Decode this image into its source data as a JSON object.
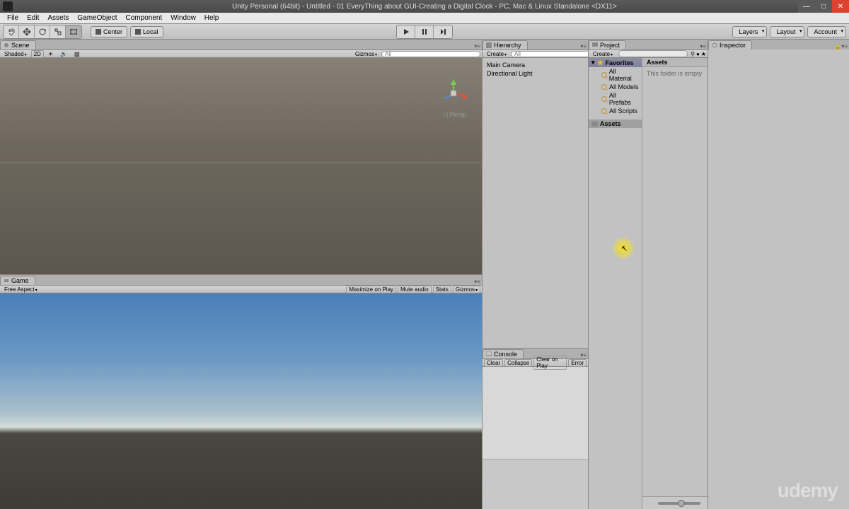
{
  "titlebar": {
    "text": "Unity Personal (64bit) - Untitled - 01 EveryThing about GUI-Creating a Digital Clock - PC, Mac & Linux Standalone <DX11>"
  },
  "menubar": [
    "File",
    "Edit",
    "Assets",
    "GameObject",
    "Component",
    "Window",
    "Help"
  ],
  "toolbar": {
    "pivot_center": "Center",
    "pivot_local": "Local",
    "layers": "Layers",
    "layout": "Layout",
    "account": "Account"
  },
  "scene": {
    "tab": "Scene",
    "shaded": "Shaded",
    "twod": "2D",
    "gizmos": "Gizmos",
    "persp": "Persp"
  },
  "game": {
    "tab": "Game",
    "aspect": "Free Aspect",
    "maximize": "Maximize on Play",
    "mute": "Mute audio",
    "stats": "Stats",
    "gizmos": "Gizmos"
  },
  "hierarchy": {
    "tab": "Hierarchy",
    "create": "Create",
    "search_placeholder": "All",
    "items": [
      "Main Camera",
      "Directional Light"
    ]
  },
  "console": {
    "tab": "Console",
    "clear": "Clear",
    "collapse": "Collapse",
    "clear_on_play": "Clear on Play",
    "error": "Error"
  },
  "project": {
    "tab": "Project",
    "create": "Create",
    "favorites": "Favorites",
    "fav_items": [
      "All Material",
      "All Models",
      "All Prefabs",
      "All Scripts"
    ],
    "assets": "Assets",
    "breadcrumb": "Assets",
    "empty_msg": "This folder is empty"
  },
  "inspector": {
    "tab": "Inspector"
  },
  "watermark": "udemy"
}
